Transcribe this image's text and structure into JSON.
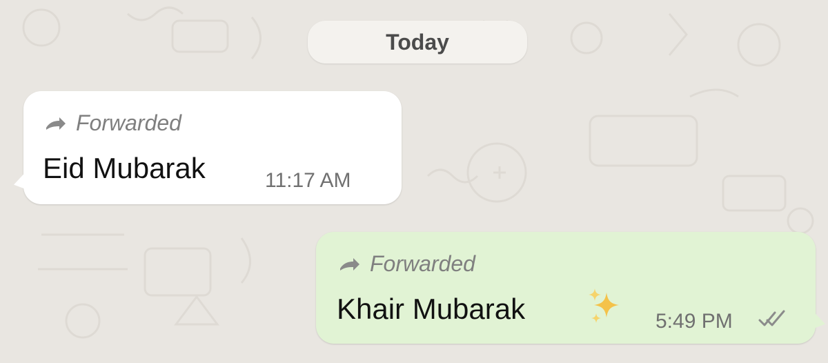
{
  "window": {
    "date_label": "Today"
  },
  "messages": [
    {
      "direction": "incoming",
      "forwarded_label": "Forwarded",
      "text": "Eid Mubarak",
      "time": "11:17 AM",
      "icons": [
        "forward-arrow-icon"
      ]
    },
    {
      "direction": "outgoing",
      "forwarded_label": "Forwarded",
      "text": "Khair Mubarak",
      "time": "5:49 PM",
      "icons": [
        "forward-arrow-icon",
        "sparkle-icon",
        "double-tick-icon"
      ]
    }
  ],
  "colors": {
    "wallpaper": "#e9e6e1",
    "incoming_bubble": "#ffffff",
    "outgoing_bubble": "#e1f3d4",
    "date_pill": "#f4f2ee",
    "forwarded_text": "#7f7f7f",
    "time_text": "#707070",
    "message_text": "#111111"
  }
}
